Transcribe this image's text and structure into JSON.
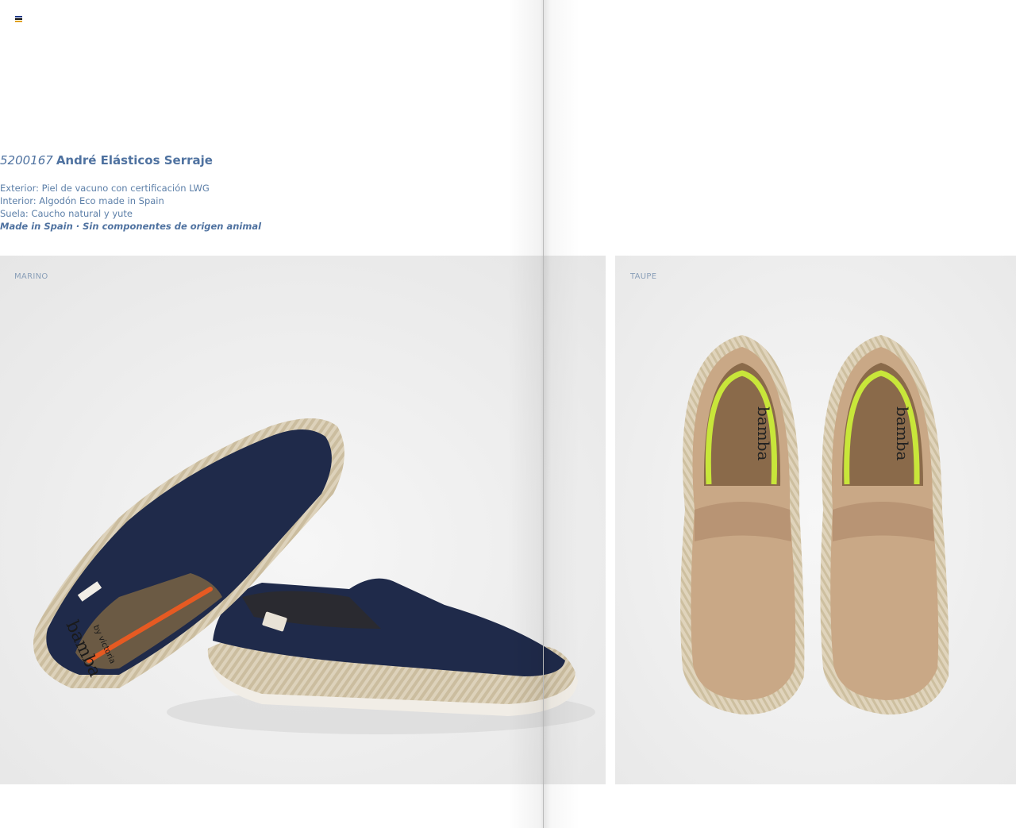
{
  "product": {
    "code": "5200167",
    "name": "André Elásticos Serraje",
    "specs": [
      "Exterior: Piel de vacuno con certificación LWG",
      "Interior: Algodón Eco made in Spain",
      "Suela: Caucho natural y yute"
    ],
    "highlight": "Made in Spain · Sin componentes de origen animal"
  },
  "variants": [
    {
      "color_label": "MARINO",
      "image": "navy-espadrille-pair-photo"
    },
    {
      "color_label": "TAUPE",
      "image": "taupe-espadrille-pair-photo"
    }
  ],
  "insole_brand": {
    "name": "bamba",
    "byline": "by victoria"
  },
  "menu_icon": "flag-menu-icon",
  "colors": {
    "text_primary": "#4f72a0",
    "navy": "#1f2a4a",
    "taupe": "#c9a886",
    "jute": "#d8ccb4"
  }
}
